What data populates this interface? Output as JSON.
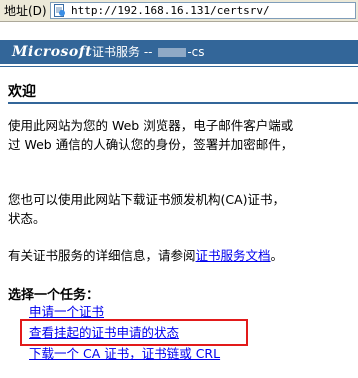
{
  "address_bar": {
    "label": "地址(D)",
    "url": "http://192.168.16.131/certsrv/",
    "icon": "page-icon"
  },
  "header": {
    "brand": "Microsoft",
    "service_prefix": "证书服务  --",
    "host_suffix": "-cs",
    "background": "#336699"
  },
  "main": {
    "welcome": "欢迎",
    "para1_line1": "使用此网站为您的 Web 浏览器，电子邮件客户端或",
    "para1_line2": "过 Web 通信的人确认您的身份，签署并加密邮件，",
    "para2_line1": "您也可以使用此网站下载证书颁发机构(CA)证书，",
    "para2_line2": "状态。",
    "para3_prefix": "有关证书服务的详细信息，请参阅",
    "para3_link": "证书服务文档",
    "para3_suffix": "。",
    "tasks_title": "选择一个任务：",
    "tasks": [
      {
        "label": "申请一个证书"
      },
      {
        "label": "查看挂起的证书申请的状态"
      },
      {
        "label": "下载一个 CA 证书，证书链或 CRL"
      }
    ]
  },
  "highlight_color": "#e21a1a",
  "link_color": "#0000ee"
}
